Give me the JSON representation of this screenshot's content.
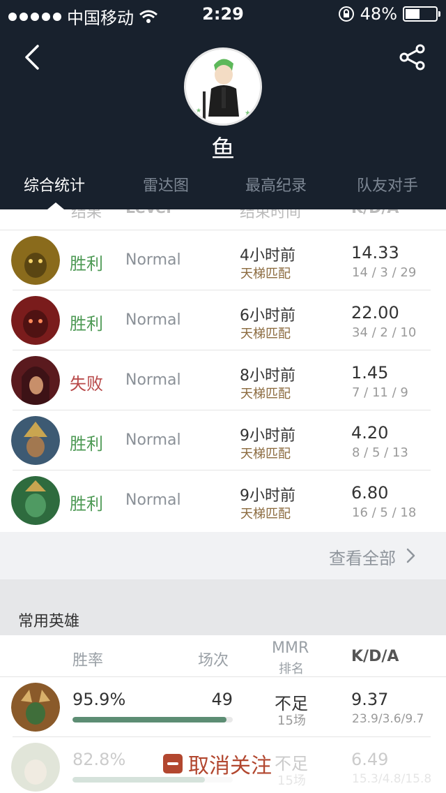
{
  "status_bar": {
    "carrier": "中国移动",
    "time": "2:29",
    "battery_text": "48%",
    "battery_level": 0.48
  },
  "profile": {
    "name": "鱼"
  },
  "tabs": [
    {
      "label": "综合统计",
      "active": true
    },
    {
      "label": "雷达图",
      "active": false
    },
    {
      "label": "最高纪录",
      "active": false
    },
    {
      "label": "队友对手",
      "active": false
    }
  ],
  "match_columns": {
    "result": "结果",
    "level": "Level",
    "end_time": "结束时间",
    "kda": "K/D/A"
  },
  "matches": [
    {
      "result": "胜利",
      "outcome": "win",
      "level": "Normal",
      "time_ago": "4小时前",
      "mode": "天梯匹配",
      "kda_ratio": "14.33",
      "kda": "14 / 3 / 29",
      "hero_color": "#8a6b1c"
    },
    {
      "result": "胜利",
      "outcome": "win",
      "level": "Normal",
      "time_ago": "6小时前",
      "mode": "天梯匹配",
      "kda_ratio": "22.00",
      "kda": "34 / 2 / 10",
      "hero_color": "#7a1c1c"
    },
    {
      "result": "失败",
      "outcome": "loss",
      "level": "Normal",
      "time_ago": "8小时前",
      "mode": "天梯匹配",
      "kda_ratio": "1.45",
      "kda": "7 / 11 / 9",
      "hero_color": "#5a1a1e"
    },
    {
      "result": "胜利",
      "outcome": "win",
      "level": "Normal",
      "time_ago": "9小时前",
      "mode": "天梯匹配",
      "kda_ratio": "4.20",
      "kda": "8 / 5 / 13",
      "hero_color": "#3d5a73"
    },
    {
      "result": "胜利",
      "outcome": "win",
      "level": "Normal",
      "time_ago": "9小时前",
      "mode": "天梯匹配",
      "kda_ratio": "6.80",
      "kda": "16 / 5 / 18",
      "hero_color": "#2e6b3e"
    }
  ],
  "view_all": {
    "label": "查看全部"
  },
  "heroes_section": {
    "title": "常用英雄",
    "columns": {
      "winrate": "胜率",
      "matches": "场次",
      "mmr": "MMR",
      "mmr_sub": "排名",
      "kda": "K/D/A"
    },
    "rows": [
      {
        "winrate": "95.9%",
        "winrate_value": 0.959,
        "matches": "49",
        "mmr": "不足",
        "mmr_sub": "15场",
        "kda_ratio": "9.37",
        "kda": "23.9/3.6/9.7",
        "hero_color": "#8a5a2a"
      },
      {
        "winrate": "82.8%",
        "winrate_value": 0.828,
        "matches": "",
        "mmr": "不足",
        "mmr_sub": "15场",
        "kda_ratio": "6.49",
        "kda": "15.3/4.8/15.8",
        "hero_color": "#8a9a6a"
      }
    ]
  },
  "unfollow": {
    "label": "取消关注"
  }
}
